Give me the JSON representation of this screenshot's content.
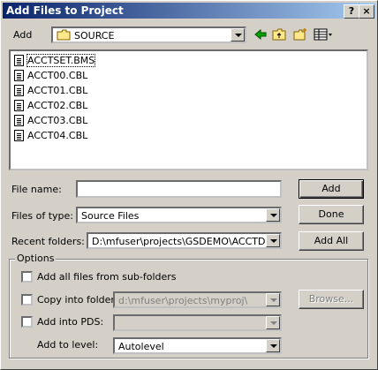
{
  "window": {
    "title": "Add Files to Project",
    "help_button": "?",
    "close_button": "×"
  },
  "lookin": {
    "label": "Add",
    "folder": "SOURCE",
    "icons": [
      "folder-icon",
      "back-arrow-icon",
      "up-folder-icon",
      "new-folder-icon",
      "view-menu-icon"
    ]
  },
  "files": [
    {
      "name": "ACCTSET.BMS",
      "icon": "bms-file-icon"
    },
    {
      "name": "ACCT00.CBL",
      "icon": "cbl-file-icon"
    },
    {
      "name": "ACCT01.CBL",
      "icon": "cbl-file-icon"
    },
    {
      "name": "ACCT02.CBL",
      "icon": "cbl-file-icon"
    },
    {
      "name": "ACCT03.CBL",
      "icon": "cbl-file-icon"
    },
    {
      "name": "ACCT04.CBL",
      "icon": "cbl-file-icon"
    }
  ],
  "form": {
    "filename_label": "File name:",
    "filename_value": "",
    "filetype_label": "Files of type:",
    "filetype_value": "Source Files",
    "recent_label": "Recent folders:",
    "recent_value": "D:\\mfuser\\projects\\GSDEMO\\ACCTDEM"
  },
  "buttons": {
    "add": "Add",
    "done": "Done",
    "add_all": "Add All",
    "browse": "Browse..."
  },
  "options": {
    "group_label": "Options",
    "subfolders_label": "Add all files from sub-folders",
    "copy_label": "Copy into folder:",
    "copy_value": "d:\\mfuser\\projects\\myproj\\",
    "pds_label": "Add into PDS:",
    "pds_value": "",
    "level_label": "Add to level:",
    "level_value": "Autolevel"
  }
}
